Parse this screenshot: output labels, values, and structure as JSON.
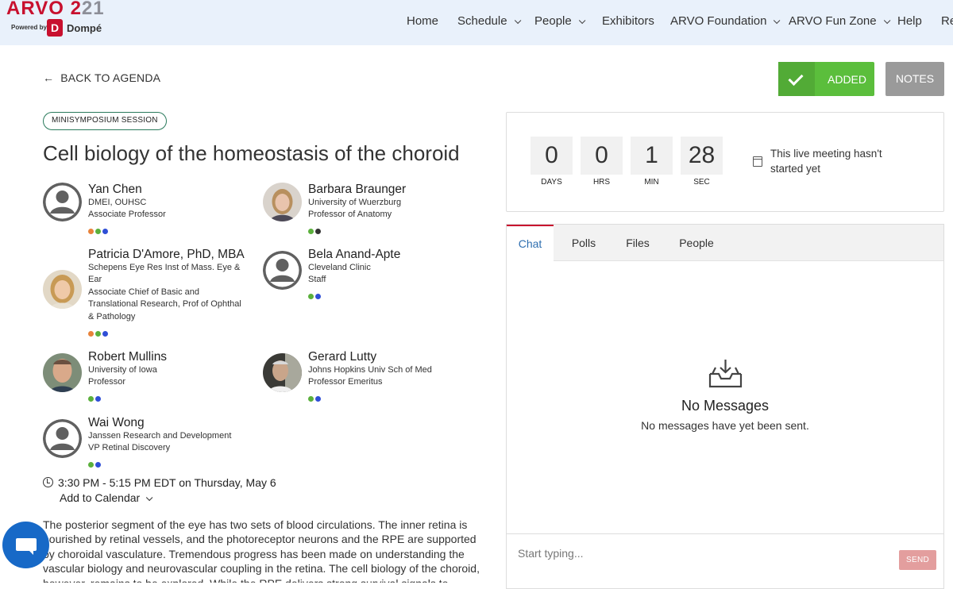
{
  "header": {
    "logo": {
      "year_prefix": "ARVO 2",
      "year_suffix": "21",
      "powered_by": "Powered by",
      "sponsor_badge": "D",
      "sponsor": "Dompé"
    },
    "nav": [
      {
        "label": "Home",
        "dropdown": false
      },
      {
        "label": "Schedule",
        "dropdown": true
      },
      {
        "label": "People",
        "dropdown": true
      },
      {
        "label": "Exhibitors",
        "dropdown": false
      },
      {
        "label": "ARVO Foundation",
        "dropdown": true
      },
      {
        "label": "ARVO Fun Zone",
        "dropdown": true
      },
      {
        "label": "Help",
        "dropdown": false
      },
      {
        "label": "Re",
        "dropdown": false
      }
    ]
  },
  "back_link": "BACK TO AGENDA",
  "actions": {
    "added_label": "ADDED",
    "notes_label": "NOTES"
  },
  "session": {
    "badge": "MINISYMPOSIUM SESSION",
    "title": "Cell biology of the homeostasis of the choroid"
  },
  "speakers": [
    {
      "name": "Yan Chen",
      "lines": [
        "DMEI, OUHSC",
        "Associate Professor"
      ],
      "dots": [
        "#e8823a",
        "#5bb03c",
        "#2f4fd6"
      ],
      "avatar": "generic"
    },
    {
      "name": "Barbara Braunger",
      "lines": [
        "University of Wuerzburg",
        "Professor of Anatomy"
      ],
      "dots": [
        "#5bb03c",
        "#333333"
      ],
      "avatar": "photo"
    },
    {
      "name": "Patricia D'Amore, PhD, MBA",
      "lines": [
        "Schepens Eye Res Inst of Mass. Eye &",
        "Ear",
        "Associate Chief of Basic and",
        "Translational Research, Prof of Ophthal",
        "& Pathology"
      ],
      "dots": [
        "#e8823a",
        "#5bb03c",
        "#2f4fd6"
      ],
      "avatar": "photo"
    },
    {
      "name": "Bela Anand-Apte",
      "lines": [
        "Cleveland Clinic",
        "Staff"
      ],
      "dots": [
        "#5bb03c",
        "#2f4fd6"
      ],
      "avatar": "generic"
    },
    {
      "name": "Robert Mullins",
      "lines": [
        "University of Iowa",
        "Professor"
      ],
      "dots": [
        "#5bb03c",
        "#2f4fd6"
      ],
      "avatar": "photo"
    },
    {
      "name": "Gerard Lutty",
      "lines": [
        "Johns Hopkins Univ Sch of Med",
        "Professor Emeritus"
      ],
      "dots": [
        "#5bb03c",
        "#2f4fd6"
      ],
      "avatar": "photo"
    },
    {
      "name": "Wai Wong",
      "lines": [
        "Janssen Research and Development",
        "VP Retinal Discovery"
      ],
      "dots": [
        "#5bb03c",
        "#2f4fd6"
      ],
      "avatar": "generic"
    }
  ],
  "schedule": {
    "time": "3:30 PM - 5:15 PM EDT on Thursday, May 6",
    "add_to_calendar": "Add to Calendar"
  },
  "description": "The posterior segment of the eye has two sets of blood circulations. The inner retina is nourished by retinal vessels, and the photoreceptor neurons and the RPE are supported by choroidal vasculature. Tremendous progress has been made on understanding the vascular biology and neurovascular coupling in the retina. The cell biology of the choroid, however, remains to be explored. While the RPE delivers strong survival signals to choroidal",
  "countdown": {
    "units": [
      {
        "value": "0",
        "label": "DAYS"
      },
      {
        "value": "0",
        "label": "HRS"
      },
      {
        "value": "1",
        "label": "MIN"
      },
      {
        "value": "28",
        "label": "SEC"
      }
    ],
    "status_text": "This live meeting hasn't started yet"
  },
  "chat": {
    "tabs": [
      "Chat",
      "Polls",
      "Files",
      "People"
    ],
    "active_tab": "Chat",
    "empty_title": "No Messages",
    "empty_subtitle": "No messages have yet been sent.",
    "input_placeholder": "Start typing...",
    "send_label": "SEND"
  },
  "colors": {
    "accent_red": "#c8102e",
    "added_green": "#5bbe3c",
    "link_blue": "#2f6fb0",
    "fab_blue": "#1769c7"
  }
}
